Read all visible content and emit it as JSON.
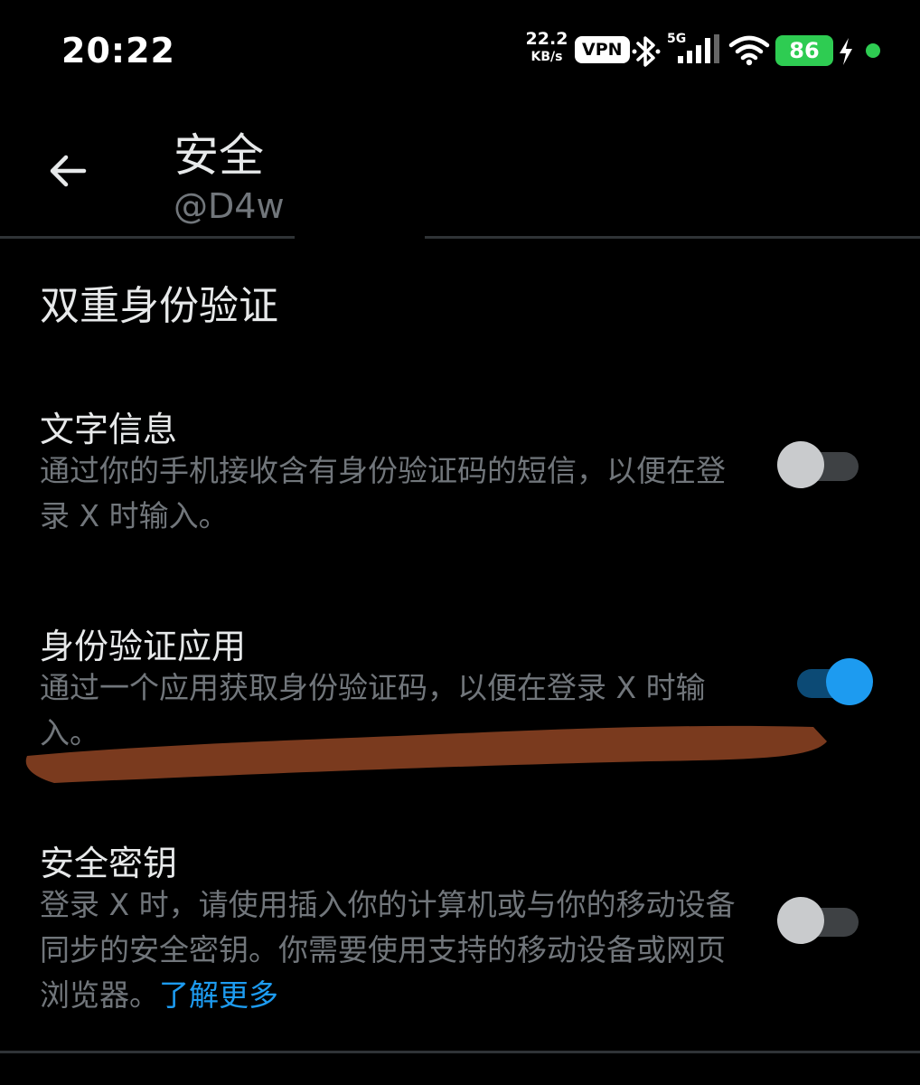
{
  "status_bar": {
    "time": "20:22",
    "net_speed_value": "22.2",
    "net_speed_unit": "KB/s",
    "vpn_label": "VPN",
    "network_type": "5G",
    "battery_level": "86",
    "battery_color": "#2ecc52",
    "icons": [
      "bluetooth-icon",
      "signal-icon",
      "wifi-icon",
      "charging-icon"
    ]
  },
  "header": {
    "title": "安全",
    "subtitle": "@D4w",
    "back_icon": "arrow-left-icon"
  },
  "section": {
    "title": "双重身份验证",
    "options": [
      {
        "title": "文字信息",
        "description": "通过你的手机接收含有身份验证码的短信，以便在登录 X 时输入。",
        "enabled": false
      },
      {
        "title": "身份验证应用",
        "description": "通过一个应用获取身份验证码，以便在登录 X 时输入。",
        "enabled": true
      },
      {
        "title": "安全密钥",
        "description": "登录 X 时，请使用插入你的计算机或与你的移动设备同步的安全密钥。你需要使用支持的移动设备或网页浏览器。",
        "link_text": "了解更多",
        "enabled": false
      }
    ]
  },
  "colors": {
    "background": "#000000",
    "primary_text": "#e7e9ea",
    "secondary_text": "#71767b",
    "accent": "#1d9bf0",
    "divider": "#2f3336",
    "redaction_stroke": "#7a3a1e"
  }
}
